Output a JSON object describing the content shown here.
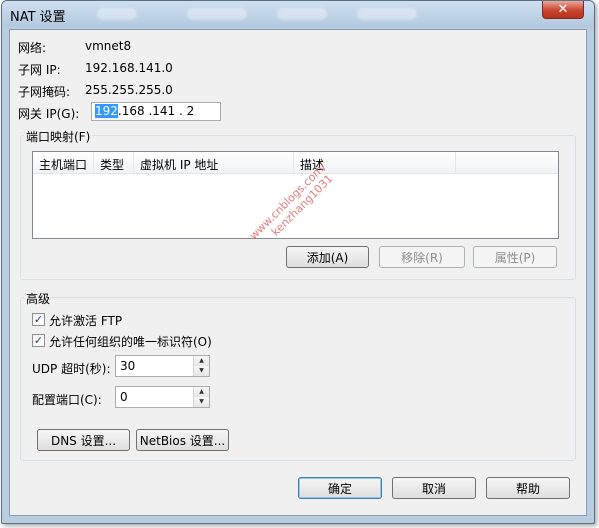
{
  "window": {
    "title": "NAT 设置",
    "close_glyph": "✕"
  },
  "info": {
    "network_label": "网络:",
    "network_value": "vmnet8",
    "subnet_ip_label": "子网 IP:",
    "subnet_ip_value": "192.168.141.0",
    "subnet_mask_label": "子网掩码:",
    "subnet_mask_value": "255.255.255.0",
    "gateway_label": "网关 IP(G):",
    "gateway_selected": "192",
    "gateway_rest": ".168 .141 . 2"
  },
  "port_mapping": {
    "title": "端口映射(F)",
    "columns": [
      "主机端口",
      "类型",
      "虚拟机 IP 地址",
      "描述"
    ],
    "add_label": "添加(A)",
    "remove_label": "移除(R)",
    "properties_label": "属性(P)"
  },
  "advanced": {
    "title": "高级",
    "allow_ftp_label": "允许激活 FTP",
    "allow_ftp_checked": true,
    "allow_oui_label": "允许任何组织的唯一标识符(O)",
    "allow_oui_checked": true,
    "udp_timeout_label": "UDP 超时(秒):",
    "udp_timeout_value": "30",
    "config_port_label": "配置端口(C):",
    "config_port_value": "0",
    "dns_button": "DNS 设置...",
    "netbios_button": "NetBios 设置..."
  },
  "footer": {
    "ok": "确定",
    "cancel": "取消",
    "help": "帮助"
  },
  "watermark": {
    "line1": "www.cnblogs.com/",
    "line2": "kenzhang1031"
  },
  "icons": {
    "check": "✓",
    "up": "▲",
    "down": "▼"
  },
  "colors": {
    "selection": "#3399ff",
    "titlebar": "#b8cde0",
    "close": "#c9452f"
  }
}
